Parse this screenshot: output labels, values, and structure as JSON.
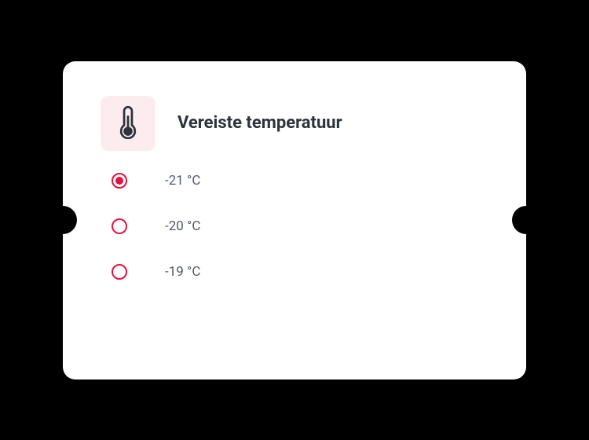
{
  "card": {
    "title": "Vereiste temperatuur",
    "icon": "thermometer-icon",
    "options": [
      {
        "label": "-21 °C",
        "selected": true
      },
      {
        "label": "-20 °C",
        "selected": false
      },
      {
        "label": "-19 °C",
        "selected": false
      }
    ],
    "colors": {
      "accent": "#e6123d",
      "icon_bg": "#fdecef"
    }
  }
}
